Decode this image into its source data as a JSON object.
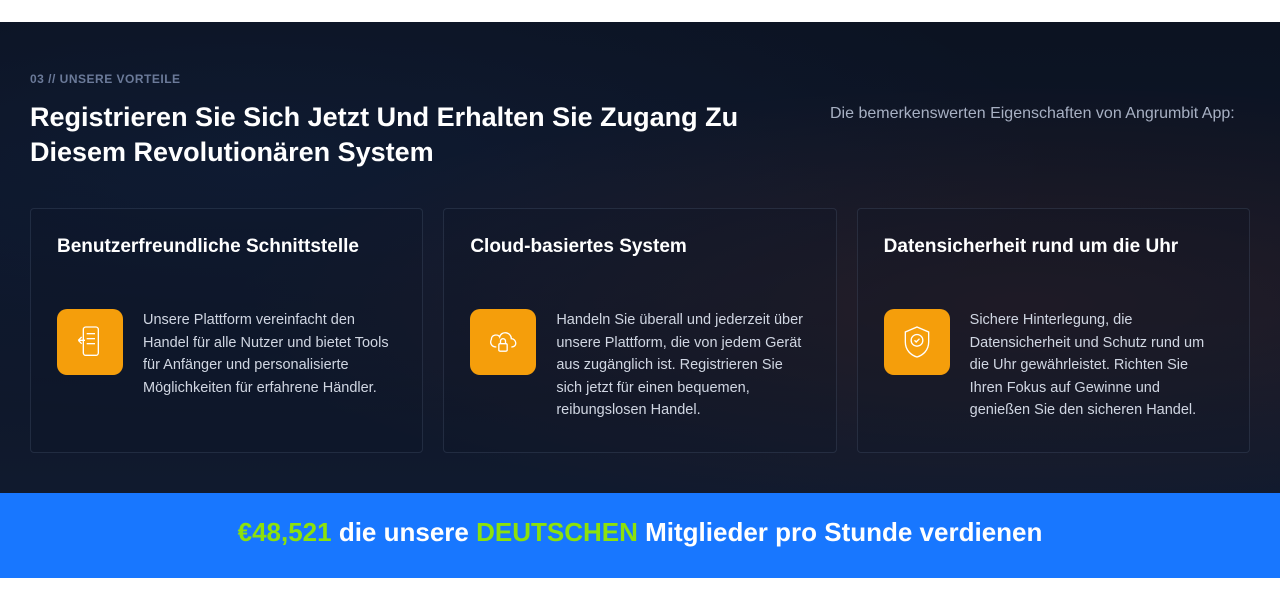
{
  "eyebrow": "03 // UNSERE VORTEILE",
  "headline": "Registrieren Sie Sich Jetzt Und Erhalten Sie Zugang Zu Diesem Revolutionären System",
  "subhead": "Die bemerkenswerten Eigenschaften von Angrumbit App:",
  "cards": [
    {
      "title": "Benutzerfreundliche Schnittstelle",
      "icon": "interface-icon",
      "text": "Unsere Plattform vereinfacht den Handel für alle Nutzer und bietet Tools für Anfänger und personalisierte Möglichkeiten für erfahrene Händler."
    },
    {
      "title": "Cloud-basiertes System",
      "icon": "cloud-lock-icon",
      "text": "Handeln Sie überall und jederzeit über unsere Plattform, die von jedem Gerät aus zugänglich ist. Registrieren Sie sich jetzt für einen bequemen, reibungslosen Handel."
    },
    {
      "title": "Datensicherheit rund um die Uhr",
      "icon": "shield-badge-icon",
      "text": "Sichere Hinterlegung, die Datensicherheit und Schutz rund um die Uhr gewährleistet. Richten Sie Ihren Fokus auf Gewinne und genießen Sie den sicheren Handel."
    }
  ],
  "banner": {
    "amount": "€48,521",
    "mid1": " die unsere ",
    "highlight": "DEUTSCHEN",
    "mid2": " Mitglieder pro Stunde verdienen"
  }
}
